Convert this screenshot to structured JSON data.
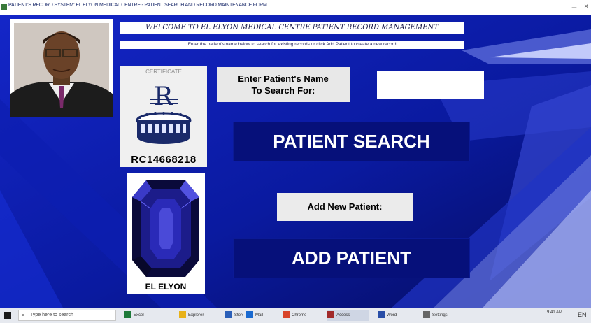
{
  "window": {
    "title": "PATIENT'S RECORD SYSTEM: EL ELYON MEDICAL CENTRE - PATIENT SEARCH AND RECORD MAINTENANCE FORM",
    "minimize_glyph": "–",
    "close_glyph": "×"
  },
  "header": {
    "banner_line1": "WELCOME TO EL ELYON MEDICAL CENTRE PATIENT RECORD MANAGEMENT",
    "banner_line2": "Enter the patient's name below to search for existing records or click Add Patient to create a new record"
  },
  "certificate": {
    "title": "CERTIFICATE",
    "rc_number": "RC14668218"
  },
  "gem": {
    "label": "EL ELYON"
  },
  "search": {
    "label": "Enter Patient's Name\nTo Search For:",
    "input_value": "",
    "button_label": "PATIENT SEARCH"
  },
  "add": {
    "label": "Add New Patient:",
    "button_label": "ADD PATIENT"
  },
  "taskbar": {
    "search_placeholder": "Type here to search",
    "items": [
      {
        "label": "Excel",
        "color": "#1e7a3a"
      },
      {
        "label": "Explorer",
        "color": "#e8b21a"
      },
      {
        "label": "Store",
        "color": "#2b5fb8"
      },
      {
        "label": "Mail",
        "color": "#1a6ad0"
      },
      {
        "label": "Chrome",
        "color": "#d8442a"
      },
      {
        "label": "Access",
        "color": "#a12a2a"
      },
      {
        "label": "Word",
        "color": "#2a4fa8"
      },
      {
        "label": "Settings",
        "color": "#666666"
      }
    ],
    "clock": "9:41 AM",
    "lang": "EN"
  },
  "colors": {
    "form_bg": "#0a1aa0",
    "button_bg": "#06107a",
    "stripe_light": "#9aa6ee",
    "stripe_mid": "#5a6ad8"
  }
}
